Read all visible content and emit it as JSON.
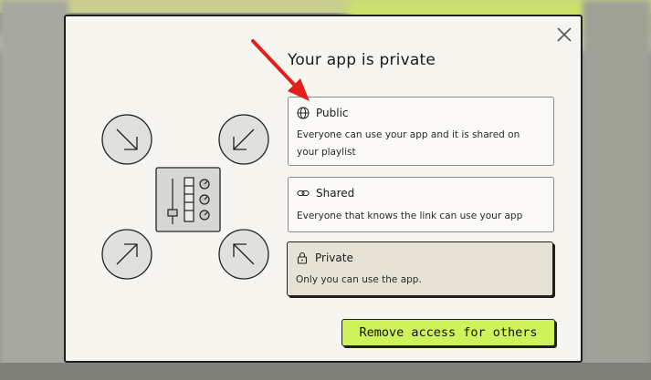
{
  "dialog": {
    "title": "Your app is private",
    "options": [
      {
        "id": "public",
        "label": "Public",
        "icon": "globe-icon",
        "description": "Everyone can use your app and it is shared on your playlist",
        "selected": false
      },
      {
        "id": "shared",
        "label": "Shared",
        "icon": "link-icon",
        "description": "Everyone that knows the link can use your app",
        "selected": false
      },
      {
        "id": "private",
        "label": "Private",
        "icon": "lock-icon",
        "description": "Only you can use the app.",
        "selected": true
      }
    ],
    "primary_button": "Remove access for others",
    "close_icon": "close-icon",
    "colors": {
      "accent": "#cdf25a",
      "annotation_arrow": "#e0201c",
      "selected_card_bg": "#e6e3d6"
    }
  }
}
